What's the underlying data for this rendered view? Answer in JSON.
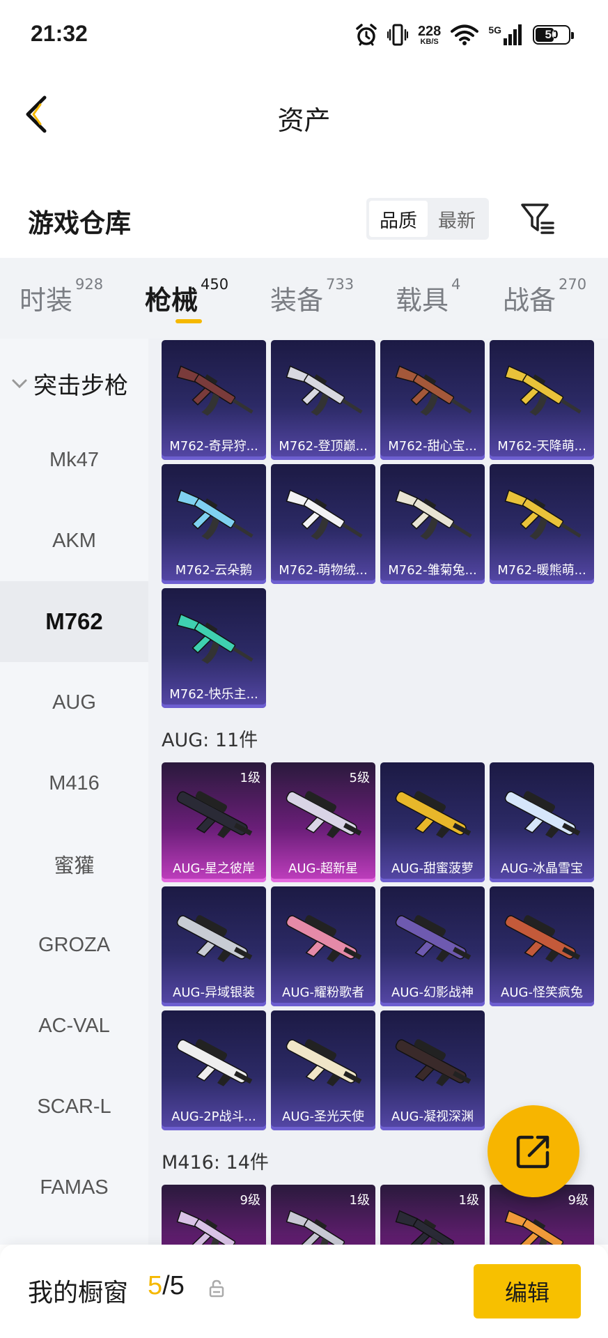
{
  "status_bar": {
    "time": "21:32",
    "net_speed": "228",
    "net_unit": "KB/S",
    "network": "5G",
    "battery": "50"
  },
  "header": {
    "title": "资产"
  },
  "warehouse": {
    "title": "游戏仓库",
    "sort_options": [
      "品质",
      "最新"
    ],
    "active_sort": "品质"
  },
  "tabs": [
    {
      "label": "时装",
      "count": "928"
    },
    {
      "label": "枪械",
      "count": "450",
      "active": true
    },
    {
      "label": "装备",
      "count": "733"
    },
    {
      "label": "载具",
      "count": "4"
    },
    {
      "label": "战备",
      "count": "270"
    }
  ],
  "sidebar": {
    "group": "突击步枪",
    "items": [
      "Mk47",
      "AKM",
      "M762",
      "AUG",
      "M416",
      "蜜獾",
      "GROZA",
      "AC-VAL",
      "SCAR-L",
      "FAMAS"
    ],
    "active": "M762"
  },
  "sections": {
    "m762": {
      "cards": [
        {
          "name": "M762-奇异狩...",
          "color": "#7a3b3b"
        },
        {
          "name": "M762-登顶巅...",
          "color": "#d8d8e0"
        },
        {
          "name": "M762-甜心宝...",
          "color": "#a4583a"
        },
        {
          "name": "M762-天降萌...",
          "color": "#e9c23a"
        },
        {
          "name": "M762-云朵鹅",
          "color": "#7fd1f0"
        },
        {
          "name": "M762-萌物绒...",
          "color": "#f2f2f4"
        },
        {
          "name": "M762-雏菊兔...",
          "color": "#e8e4d4"
        },
        {
          "name": "M762-暖熊萌...",
          "color": "#e9c23a"
        },
        {
          "name": "M762-快乐主...",
          "color": "#3fd0b0"
        }
      ]
    },
    "aug": {
      "title": "AUG: 11件",
      "cards": [
        {
          "name": "AUG-星之彼岸",
          "level": "1级",
          "rare": true,
          "color": "#2a2a36"
        },
        {
          "name": "AUG-超新星",
          "level": "5级",
          "rare": true,
          "color": "#d9d4e6"
        },
        {
          "name": "AUG-甜蜜菠萝",
          "color": "#e8b72a"
        },
        {
          "name": "AUG-冰晶雪宝",
          "color": "#d6e6fa"
        },
        {
          "name": "AUG-异域银装",
          "color": "#c8ccd4"
        },
        {
          "name": "AUG-耀粉歌者",
          "color": "#e58aa8"
        },
        {
          "name": "AUG-幻影战神",
          "color": "#6e5ab0"
        },
        {
          "name": "AUG-怪笑疯兔",
          "color": "#c45a3a"
        },
        {
          "name": "AUG-2P战斗...",
          "color": "#eeeeee"
        },
        {
          "name": "AUG-圣光天使",
          "color": "#f0e6c8"
        },
        {
          "name": "AUG-凝视深渊",
          "color": "#3a2a2a"
        }
      ]
    },
    "m416": {
      "title": "M416: 14件",
      "cards": [
        {
          "level": "9级",
          "rare": true,
          "color": "#d9c2e6"
        },
        {
          "level": "1级",
          "rare": true,
          "color": "#c8c8d4"
        },
        {
          "level": "1级",
          "rare": true,
          "color": "#2a2a36"
        },
        {
          "level": "9级",
          "rare": true,
          "color": "#f09a3a"
        }
      ]
    }
  },
  "bottom_bar": {
    "label": "我的橱窗",
    "current": "5",
    "total": "/5",
    "edit_label": "编辑"
  },
  "colors": {
    "accent": "#f5b800",
    "card_epic": "#2c2a66",
    "card_legendary": "#c23fc0"
  }
}
